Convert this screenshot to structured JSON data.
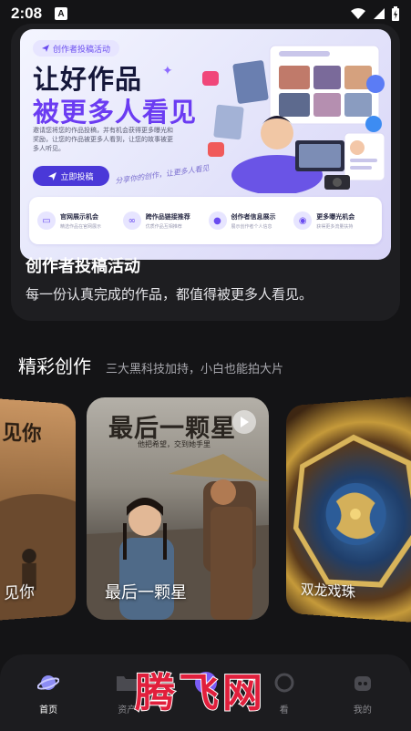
{
  "status_bar": {
    "time": "2:08",
    "notification_icon": "A"
  },
  "banner": {
    "pill": "创作者投稿活动",
    "headline_line1": "让好作品",
    "headline_line2": "被更多人看见",
    "description": "邀请您将您的作品投稿，并有机会获得更多曝光和奖励，让您的作品被更多人看到，让您的故事被更多人听见。",
    "cta": "立即投稿",
    "script_text": "分享你的创作，让更多人看见",
    "features": [
      {
        "icon": "monitor-icon",
        "title": "官网展示机会",
        "sub": "精选作品在官网展示"
      },
      {
        "icon": "link-icon",
        "title": "跨作品链接推荐",
        "sub": "优质作品互相推荐"
      },
      {
        "icon": "user-icon",
        "title": "创作者信息展示",
        "sub": "展示创作者个人信息"
      },
      {
        "icon": "eye-icon",
        "title": "更多曝光机会",
        "sub": "获得更多流量扶持"
      }
    ],
    "accent_color": "#6b3cf2"
  },
  "card": {
    "title": "创作者投稿活动",
    "description": "每一份认真完成的作品，都值得被更多人看见。"
  },
  "section": {
    "title": "精彩创作",
    "subtitle": "三大黑科技加持，小白也能拍大片"
  },
  "carousel": {
    "items": [
      {
        "label": "见你",
        "corner_text": "见你"
      },
      {
        "label": "最后一颗星",
        "calligraphy": "最后一颗星",
        "calligraphy_sub": "他把希望，交到她手里"
      },
      {
        "label": "双龙戏珠"
      }
    ]
  },
  "bottom_nav": {
    "items": [
      {
        "label": "首页",
        "icon": "planet-icon",
        "active": true
      },
      {
        "label": "资产",
        "icon": "folder-icon",
        "active": false
      },
      {
        "label": "",
        "icon": "create-icon",
        "active": false
      },
      {
        "label": "看",
        "icon": "watch-icon",
        "active": false
      },
      {
        "label": "我的",
        "icon": "robot-icon",
        "active": false
      }
    ]
  },
  "watermark": "腾飞网"
}
